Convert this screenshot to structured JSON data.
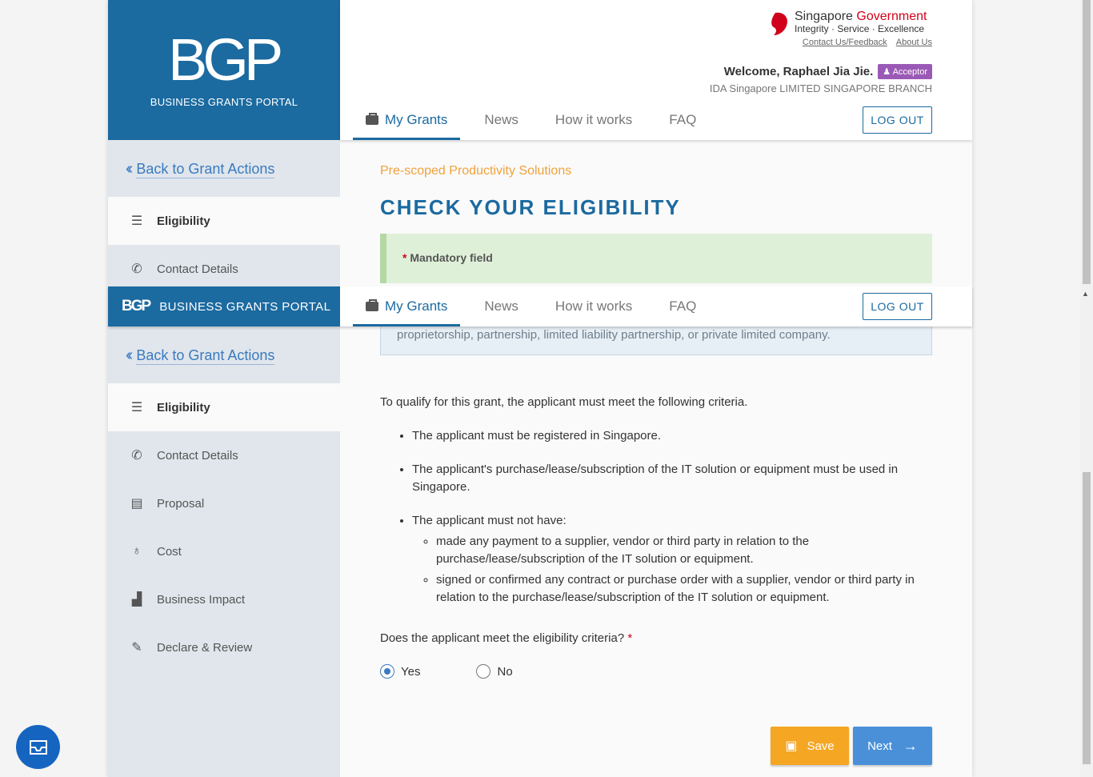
{
  "logo": {
    "mark": "BGP",
    "text": "BUSINESS GRANTS PORTAL"
  },
  "govt": {
    "singapore": "Singapore",
    "government": "Government",
    "tagline": "Integrity · Service · Excellence",
    "contact": "Contact Us/Feedback",
    "about": "About Us"
  },
  "user": {
    "welcome": "Welcome, Raphael Jia Jie.",
    "role": "Acceptor",
    "org": "IDA Singapore LIMITED SINGAPORE BRANCH"
  },
  "nav": {
    "my_grants": "My Grants",
    "news": "News",
    "how": "How it works",
    "faq": "FAQ",
    "logout": "LOG OUT"
  },
  "sidebar": {
    "back": "Back to Grant Actions",
    "items": [
      {
        "label": "Eligibility",
        "icon": "list-icon"
      },
      {
        "label": "Contact Details",
        "icon": "phone-icon"
      },
      {
        "label": "Proposal",
        "icon": "document-icon"
      },
      {
        "label": "Cost",
        "icon": "piggy-bank-icon"
      },
      {
        "label": "Business Impact",
        "icon": "bar-chart-icon"
      },
      {
        "label": "Declare & Review",
        "icon": "pen-icon"
      }
    ]
  },
  "content": {
    "subtitle": "Pre-scoped Productivity Solutions",
    "title": "CHECK YOUR ELIGIBILITY",
    "mandatory": "Mandatory field",
    "info": "proprietorship, partnership, limited liability partnership, or private limited company.",
    "intro": "To qualify for this grant, the applicant must meet the following criteria.",
    "criteria": [
      "The applicant must be registered in Singapore.",
      "The applicant's purchase/lease/subscription of the IT solution or equipment must be used in Singapore.",
      "The applicant must not have:"
    ],
    "sub_criteria": [
      "made any payment to a supplier, vendor or third party in relation to the purchase/lease/subscription of the IT solution or equipment.",
      "signed or confirmed any contract or purchase order with a supplier, vendor or third party in relation to the purchase/lease/subscription of the IT solution or equipment."
    ],
    "question": "Does the applicant meet the eligibility criteria?",
    "yes": "Yes",
    "no": "No",
    "selected": "Yes"
  },
  "buttons": {
    "save": "Save",
    "next": "Next"
  },
  "colors": {
    "brand": "#1b6aa0",
    "accent": "#f5a623",
    "next": "#4a90d9",
    "role_badge": "#9b59b6"
  }
}
